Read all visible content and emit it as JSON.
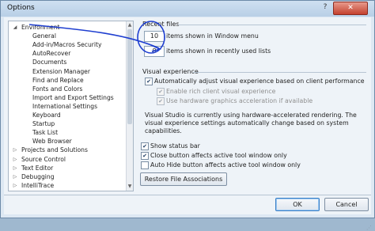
{
  "window": {
    "title": "Options",
    "help_glyph": "?",
    "close_glyph": "✕"
  },
  "tree": {
    "items": [
      {
        "label": "Environment",
        "expanded": true,
        "level": 0
      },
      {
        "label": "General",
        "level": 1
      },
      {
        "label": "Add-in/Macros Security",
        "level": 1
      },
      {
        "label": "AutoRecover",
        "level": 1
      },
      {
        "label": "Documents",
        "level": 1
      },
      {
        "label": "Extension Manager",
        "level": 1
      },
      {
        "label": "Find and Replace",
        "level": 1
      },
      {
        "label": "Fonts and Colors",
        "level": 1
      },
      {
        "label": "Import and Export Settings",
        "level": 1
      },
      {
        "label": "International Settings",
        "level": 1
      },
      {
        "label": "Keyboard",
        "level": 1
      },
      {
        "label": "Startup",
        "level": 1
      },
      {
        "label": "Task List",
        "level": 1
      },
      {
        "label": "Web Browser",
        "level": 1
      },
      {
        "label": "Projects and Solutions",
        "expanded": false,
        "level": 0
      },
      {
        "label": "Source Control",
        "expanded": false,
        "level": 0
      },
      {
        "label": "Text Editor",
        "expanded": false,
        "level": 0
      },
      {
        "label": "Debugging",
        "expanded": false,
        "level": 0
      },
      {
        "label": "IntelliTrace",
        "expanded": false,
        "level": 0
      }
    ]
  },
  "recent_files": {
    "title": "Recent files",
    "window_menu_count": "10",
    "window_menu_label": "items shown in Window menu",
    "recent_used_count": "8",
    "recent_used_label": "items shown in recently used lists"
  },
  "visual_experience": {
    "title": "Visual experience",
    "auto_adjust": {
      "label": "Automatically adjust visual experience based on client performance",
      "checked": true
    },
    "rich_client": {
      "label": "Enable rich client visual experience",
      "checked": true
    },
    "hw_accel": {
      "label": "Use hardware graphics acceleration if available",
      "checked": true
    },
    "description": "Visual Studio is currently using hardware-accelerated rendering. The visual experience settings automatically change based on system capabilities."
  },
  "options": {
    "show_status_bar": {
      "label": "Show status bar",
      "checked": true
    },
    "close_button": {
      "label": "Close button affects active tool window only",
      "checked": true
    },
    "auto_hide": {
      "label": "Auto Hide button affects active tool window only",
      "checked": false
    }
  },
  "buttons": {
    "restore": "Restore File Associations",
    "ok": "OK",
    "cancel": "Cancel"
  },
  "colors": {
    "annotation_ink": "#1f3fd0"
  }
}
